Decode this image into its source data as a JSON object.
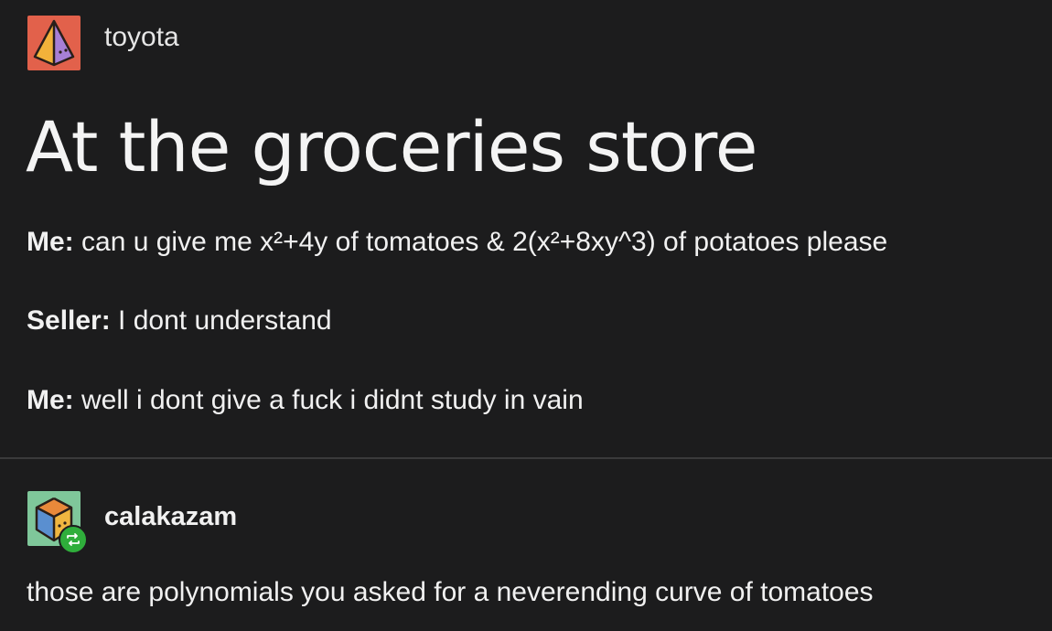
{
  "post": {
    "username": "toyota",
    "title": "At the groceries store",
    "lines": [
      {
        "speaker": "Me:",
        "text": " can u give me x²+4y of tomatoes & 2(x²+8xy^3) of potatoes please"
      },
      {
        "speaker": "Seller:",
        "text": " I dont understand"
      },
      {
        "speaker": "Me:",
        "text": " well i dont give a fuck i didnt study in vain"
      }
    ]
  },
  "reblog": {
    "username": "calakazam",
    "text": "those are polynomials you asked for a neverending curve of tomatoes"
  },
  "colors": {
    "background": "#1c1c1d",
    "text": "#f4f4f4",
    "divider": "#3a3a3b",
    "avatar1_bg": "#e2614b",
    "avatar2_bg": "#7fc79a",
    "reblog_badge": "#2fae3b"
  },
  "icons": {
    "avatar1": "pyramid-icon",
    "avatar2": "cube-icon",
    "badge": "reblog-icon"
  }
}
